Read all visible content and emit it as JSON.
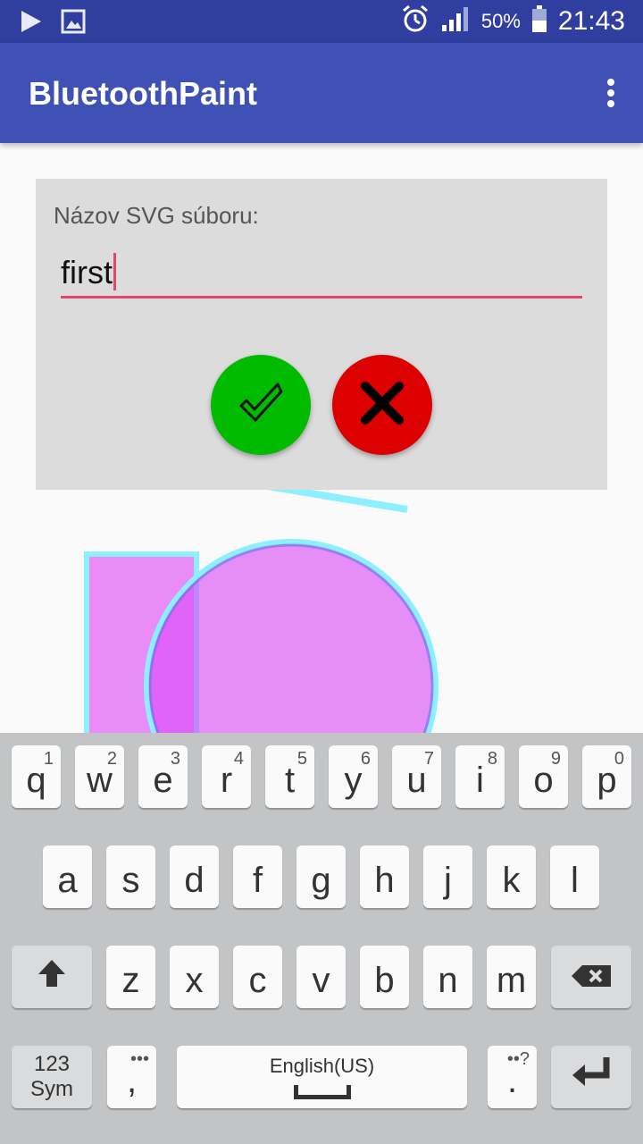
{
  "status_bar": {
    "left_icons": [
      "play-icon",
      "image-icon"
    ],
    "right_icons": [
      "alarm-icon",
      "signal-icon",
      "battery-icon"
    ],
    "battery_percent": "50%",
    "time": "21:43"
  },
  "app_bar": {
    "title": "BluetoothPaint",
    "overflow_icon": "more-vert-icon"
  },
  "dialog": {
    "label": "Názov SVG súboru:",
    "input_value": "first",
    "confirm_icon": "checkmark-icon",
    "cancel_icon": "close-icon"
  },
  "colors": {
    "status_bar": "#303f9f",
    "app_bar": "#3f51b5",
    "accent": "#e5446d",
    "confirm": "#00bb00",
    "cancel": "#dd0000",
    "shape_fill": "#e98cf8",
    "shape_stroke": "#8cf0ff"
  },
  "keyboard": {
    "row1": [
      {
        "key": "q",
        "hint": "1"
      },
      {
        "key": "w",
        "hint": "2"
      },
      {
        "key": "e",
        "hint": "3"
      },
      {
        "key": "r",
        "hint": "4"
      },
      {
        "key": "t",
        "hint": "5"
      },
      {
        "key": "y",
        "hint": "6"
      },
      {
        "key": "u",
        "hint": "7"
      },
      {
        "key": "i",
        "hint": "8"
      },
      {
        "key": "o",
        "hint": "9"
      },
      {
        "key": "p",
        "hint": "0"
      }
    ],
    "row2": [
      "a",
      "s",
      "d",
      "f",
      "g",
      "h",
      "j",
      "k",
      "l"
    ],
    "row3": [
      "z",
      "x",
      "c",
      "v",
      "b",
      "n",
      "m"
    ],
    "sym_line1": "123",
    "sym_line2": "Sym",
    "comma": ",",
    "comma_hint": "•••",
    "space_label": "English(US)",
    "period": ".",
    "period_hint": "••?",
    "shift_icon": "shift-icon",
    "backspace_icon": "backspace-icon",
    "enter_icon": "enter-icon"
  }
}
